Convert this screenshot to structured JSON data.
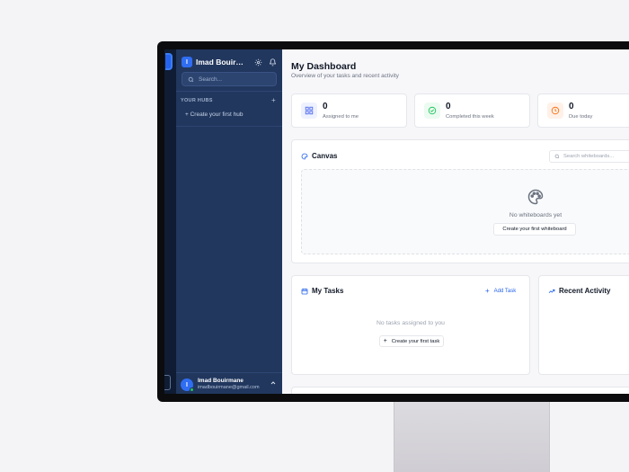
{
  "sidebar": {
    "workspace_initial": "I",
    "workspace_name": "Imad Bouirmane's Workspace",
    "search_placeholder": "Search...",
    "hubs_label": "YOUR HUBS",
    "hubs_add": "+",
    "create_hub": "+ Create your first hub",
    "user": {
      "initial": "I",
      "name": "Imad Bouirmane",
      "email": "imadbouirmane@gmail.com"
    }
  },
  "header": {
    "title": "My Dashboard",
    "subtitle": "Overview of your tasks and recent activity"
  },
  "stats": [
    {
      "value": "0",
      "label": "Assigned to me",
      "icon": "grid-icon",
      "color": "#4f6bed"
    },
    {
      "value": "0",
      "label": "Completed this week",
      "icon": "check-circle-icon",
      "color": "#22c55e"
    },
    {
      "value": "0",
      "label": "Due today",
      "icon": "clock-icon",
      "color": "#f97316"
    }
  ],
  "canvas": {
    "title": "Canvas",
    "search_placeholder": "Search whiteboards...",
    "empty_text": "No whiteboards yet",
    "create_button": "Create your first whiteboard"
  },
  "tasks": {
    "title": "My Tasks",
    "add_label": "Add Task",
    "empty_text": "No tasks assigned to you",
    "create_button": "Create your first task"
  },
  "activity": {
    "title": "Recent Activity"
  },
  "colors": {
    "sidebar_bg": "#21375e",
    "accent": "#2563eb"
  }
}
